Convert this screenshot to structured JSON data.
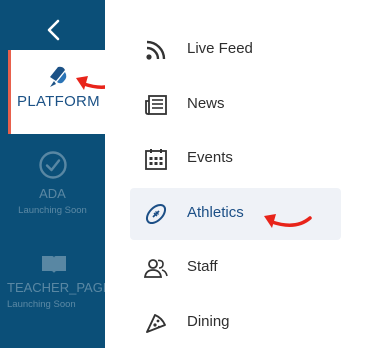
{
  "accent_color": "#e8604c",
  "rail_color": "#0b4f78",
  "rail": {
    "back_icon": "chevron-left-icon",
    "platform": {
      "label": "PLATFORM",
      "icon": "platform-logo-icon"
    },
    "items": [
      {
        "title": "ADA",
        "subtitle": "Launching Soon",
        "icon": "check-circle-icon"
      },
      {
        "title": "TEACHER_PAGE",
        "subtitle": "Launching Soon",
        "icon": "open-book-icon"
      }
    ]
  },
  "menu": {
    "items": [
      {
        "label": "Live Feed",
        "icon": "rss-feed-icon"
      },
      {
        "label": "News",
        "icon": "newspaper-icon"
      },
      {
        "label": "Events",
        "icon": "calendar-icon"
      },
      {
        "label": "Athletics",
        "icon": "football-icon",
        "active": true
      },
      {
        "label": "Staff",
        "icon": "people-icon"
      },
      {
        "label": "Dining",
        "icon": "pizza-icon"
      }
    ]
  }
}
